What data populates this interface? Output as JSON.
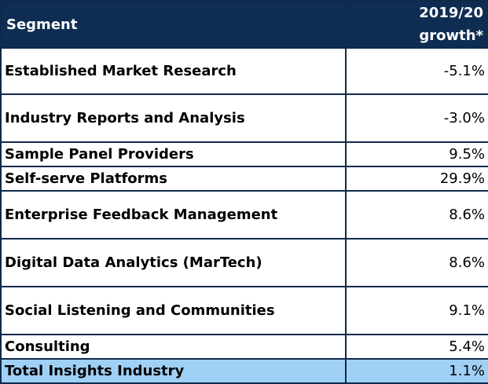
{
  "chart_data": {
    "type": "table",
    "columns": [
      "Segment",
      "2019/20 growth*"
    ],
    "rows": [
      {
        "segment": "Established Market Research",
        "growth": "-5.1%"
      },
      {
        "segment": "Industry Reports and Analysis",
        "growth": "-3.0%"
      },
      {
        "segment": "Sample Panel Providers",
        "growth": "9.5%"
      },
      {
        "segment": "Self-serve Platforms",
        "growth": "29.9%"
      },
      {
        "segment": "Enterprise Feedback Management",
        "growth": "8.6%"
      },
      {
        "segment": "Digital Data Analytics (MarTech)",
        "growth": "8.6%"
      },
      {
        "segment": "Social Listening and Communities",
        "growth": "9.1%"
      },
      {
        "segment": "Consulting",
        "growth": "5.4%"
      }
    ],
    "total": {
      "segment": "Total Insights Industry",
      "growth": "1.1%"
    }
  },
  "colors": {
    "header_bg": "#0f2d52",
    "header_text": "#ffffff",
    "total_row_bg": "#9fd0f5",
    "border": "#0e2a4b"
  }
}
